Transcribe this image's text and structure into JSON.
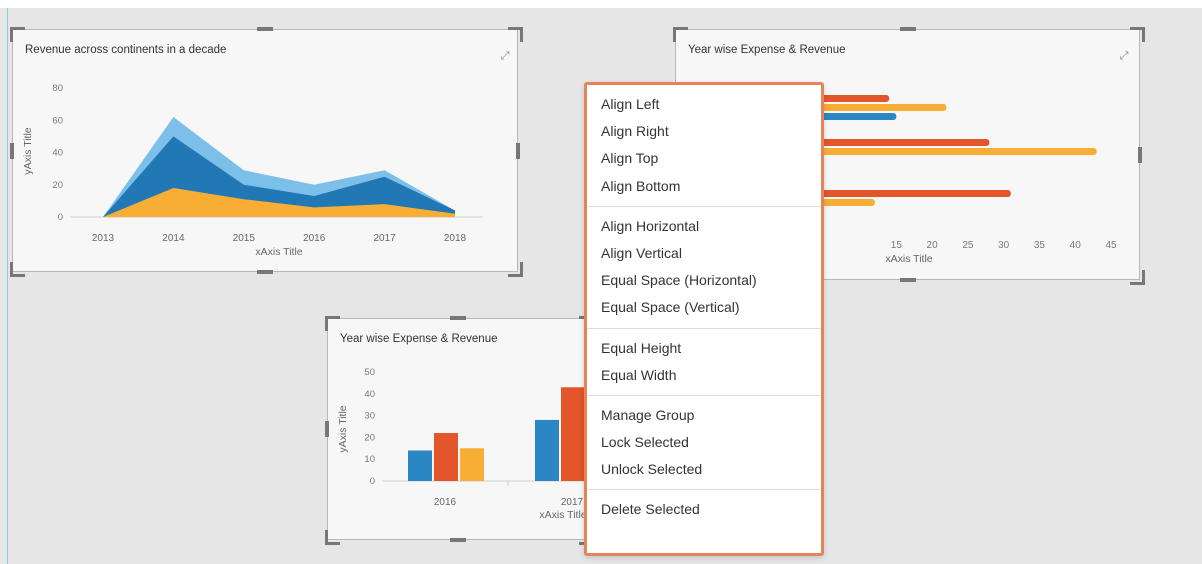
{
  "widgets": {
    "area": {
      "title": "Revenue across continents in a decade",
      "expand_icon": "expand-icon"
    },
    "hbar": {
      "title": "Year wise Expense & Revenue",
      "expand_icon": "expand-icon"
    },
    "vbar": {
      "title": "Year wise Expense & Revenue"
    }
  },
  "chart_data": [
    {
      "type": "area",
      "title": "Revenue across continents in a decade",
      "xlabel": "xAxis Title",
      "ylabel": "yAxis Title",
      "categories": [
        "2013",
        "2014",
        "2015",
        "2016",
        "2017",
        "2018"
      ],
      "yticks": [
        "0",
        "20",
        "40",
        "60",
        "80"
      ],
      "ylim": [
        0,
        80
      ],
      "series": [
        {
          "color": "#7cc0ea",
          "values": [
            0,
            62,
            29,
            20,
            29,
            4
          ]
        },
        {
          "color": "#2178b5",
          "values": [
            0,
            50,
            20,
            13,
            25,
            4
          ]
        },
        {
          "color": "#f8ad35",
          "values": [
            0,
            18,
            11,
            6,
            8,
            2
          ]
        }
      ]
    },
    {
      "type": "bar",
      "orientation": "horizontal",
      "title": "Year wise Expense & Revenue",
      "xlabel": "xAxis Title",
      "xticks_visible": [
        "15",
        "20",
        "25",
        "30",
        "35",
        "40",
        "45"
      ],
      "xlim": [
        0,
        45
      ],
      "groups": [
        {
          "bars": [
            {
              "color": "#e3552a",
              "value": 14
            },
            {
              "color": "#f8ad35",
              "value": 22
            },
            {
              "color": "#2b86c5",
              "value": 15
            }
          ]
        },
        {
          "bars": [
            {
              "color": "#e3552a",
              "value": 28
            },
            {
              "color": "#f8ad35",
              "value": 43
            }
          ]
        },
        {
          "bars": [
            {
              "color": "#e3552a",
              "value": 31
            },
            {
              "color": "#f8ad35",
              "value": 12
            }
          ]
        }
      ]
    },
    {
      "type": "bar",
      "title": "Year wise Expense & Revenue",
      "xlabel": "xAxis Title",
      "ylabel": "yAxis Title",
      "categories": [
        "2016",
        "2017"
      ],
      "yticks": [
        "0",
        "10",
        "20",
        "30",
        "40",
        "50"
      ],
      "ylim": [
        0,
        50
      ],
      "series": [
        {
          "color": "#2b86c5",
          "values": [
            14,
            28
          ]
        },
        {
          "color": "#e3552a",
          "values": [
            22,
            43
          ]
        },
        {
          "color": "#f8ad35",
          "values": [
            15,
            0
          ]
        }
      ]
    }
  ],
  "context_menu": {
    "groups": [
      [
        "Align Left",
        "Align Right",
        "Align Top",
        "Align Bottom"
      ],
      [
        "Align Horizontal",
        "Align Vertical",
        "Equal Space (Horizontal)",
        "Equal Space (Vertical)"
      ],
      [
        "Equal Height",
        "Equal Width"
      ],
      [
        "Manage Group",
        "Lock Selected",
        "Unlock Selected"
      ],
      [
        "Delete Selected"
      ]
    ]
  },
  "colors": {
    "menu_border": "#e8825a",
    "handle": "#777777"
  }
}
